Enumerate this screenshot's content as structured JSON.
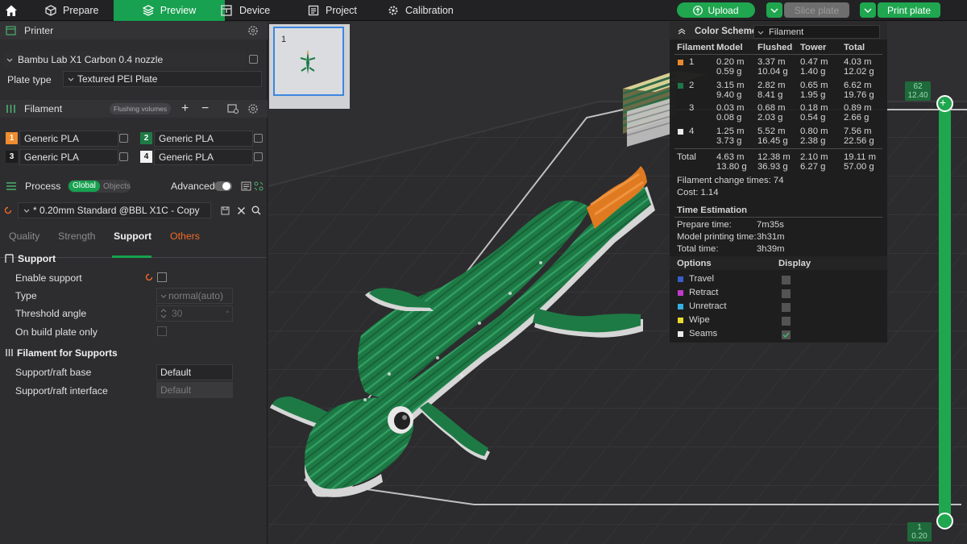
{
  "topbar": {
    "prepare": "Prepare",
    "preview": "Preview",
    "device": "Device",
    "project": "Project",
    "calibration": "Calibration",
    "upload": "Upload",
    "slice_plate": "Slice plate",
    "print_plate": "Print plate"
  },
  "printer": {
    "title": "Printer",
    "model": "Bambu Lab X1 Carbon 0.4 nozzle",
    "plate_type_label": "Plate type",
    "plate_type": "Textured PEI Plate"
  },
  "filament": {
    "title": "Filament",
    "flushing": "Flushing volumes",
    "slots": [
      {
        "num": "1",
        "name": "Generic PLA",
        "color": "#f08c2e"
      },
      {
        "num": "2",
        "name": "Generic PLA",
        "color": "#1e7a45"
      },
      {
        "num": "3",
        "name": "Generic PLA",
        "color": "#1c1c1c"
      },
      {
        "num": "4",
        "name": "Generic PLA",
        "color": "#f2f2f2"
      }
    ]
  },
  "process": {
    "title": "Process",
    "global": "Global",
    "objects": "Objects",
    "advanced": "Advanced",
    "preset": "* 0.20mm Standard @BBL X1C - Copy",
    "tabs": [
      "Quality",
      "Strength",
      "Support",
      "Others"
    ],
    "active_tab": "Support"
  },
  "support": {
    "title": "Support",
    "enable": "Enable support",
    "type_label": "Type",
    "type_value": "normal(auto)",
    "threshold_label": "Threshold angle",
    "threshold_value": "30",
    "threshold_unit": "°",
    "build_plate_only": "On build plate only",
    "fil_title": "Filament for Supports",
    "base_label": "Support/raft base",
    "base_value": "Default",
    "iface_label": "Support/raft interface",
    "iface_value": "Default"
  },
  "plate": {
    "number": "1"
  },
  "stats": {
    "color_scheme": "Color Scheme",
    "scheme_value": "Filament",
    "headers": [
      "Filament",
      "Model",
      "Flushed",
      "Tower",
      "Total"
    ],
    "rows": [
      {
        "id": "1",
        "color": "#f08c2e",
        "model": [
          "0.20 m",
          "0.59 g"
        ],
        "flushed": [
          "3.37 m",
          "10.04 g"
        ],
        "tower": [
          "0.47 m",
          "1.40 g"
        ],
        "total": [
          "4.03 m",
          "12.02 g"
        ]
      },
      {
        "id": "2",
        "color": "#1e7a45",
        "model": [
          "3.15 m",
          "9.40 g"
        ],
        "flushed": [
          "2.82 m",
          "8.41 g"
        ],
        "tower": [
          "0.65 m",
          "1.95 g"
        ],
        "total": [
          "6.62 m",
          "19.76 g"
        ]
      },
      {
        "id": "3",
        "color": "#1e1e1f",
        "model": [
          "0.03 m",
          "0.08 g"
        ],
        "flushed": [
          "0.68 m",
          "2.03 g"
        ],
        "tower": [
          "0.18 m",
          "0.54 g"
        ],
        "total": [
          "0.89 m",
          "2.66 g"
        ]
      },
      {
        "id": "4",
        "color": "#f2f2f2",
        "model": [
          "1.25 m",
          "3.73 g"
        ],
        "flushed": [
          "5.52 m",
          "16.45 g"
        ],
        "tower": [
          "0.80 m",
          "2.38 g"
        ],
        "total": [
          "7.56 m",
          "22.56 g"
        ]
      }
    ],
    "total": {
      "label": "Total",
      "model": [
        "4.63 m",
        "13.80 g"
      ],
      "flushed": [
        "12.38 m",
        "36.93 g"
      ],
      "tower": [
        "2.10 m",
        "6.27 g"
      ],
      "total": [
        "19.11 m",
        "57.00 g"
      ]
    },
    "change_times": "Filament change times:  74",
    "cost": "Cost:  1.14",
    "time_title": "Time Estimation",
    "prepare_label": "Prepare time:",
    "prepare_value": "7m35s",
    "model_label": "Model printing time:",
    "model_value": "3h31m",
    "total_label": "Total time:",
    "total_value": "3h39m",
    "options_title": "Options",
    "display_title": "Display",
    "options": [
      {
        "name": "Travel",
        "color": "#3a5fcf",
        "checked": false
      },
      {
        "name": "Retract",
        "color": "#c63bd0",
        "checked": false
      },
      {
        "name": "Unretract",
        "color": "#37b4e6",
        "checked": false
      },
      {
        "name": "Wipe",
        "color": "#f0e030",
        "checked": false
      },
      {
        "name": "Seams",
        "color": "#f2f2f2",
        "checked": true
      }
    ]
  },
  "layer_slider": {
    "top_layer": "62",
    "top_height": "12.40",
    "bottom_layer": "1",
    "bottom_height": "0.20"
  },
  "colors": {
    "accent": "#17a150",
    "model_green": "#1e7a45",
    "model_orange": "#e07a20"
  }
}
